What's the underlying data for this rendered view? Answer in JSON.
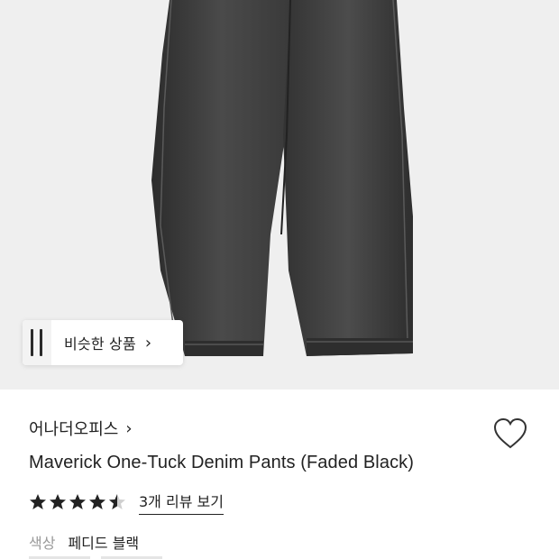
{
  "similar_button": {
    "label": "비슷한 상품",
    "chevron": "›"
  },
  "product": {
    "brand": "어나더오피스",
    "brand_chevron": "›",
    "title": "Maverick One-Tuck Denim Pants (Faded Black)",
    "rating": 4.5,
    "reviews_label": "3개 리뷰 보기",
    "color_label": "색상",
    "color_value": "페디드 블랙"
  },
  "icons": {
    "wishlist": "heart-outline-icon",
    "rating": "star-icon"
  },
  "colors": {
    "background": "#efefef",
    "denim": "#3a3a3a",
    "text": "#222222",
    "muted": "#999999"
  }
}
